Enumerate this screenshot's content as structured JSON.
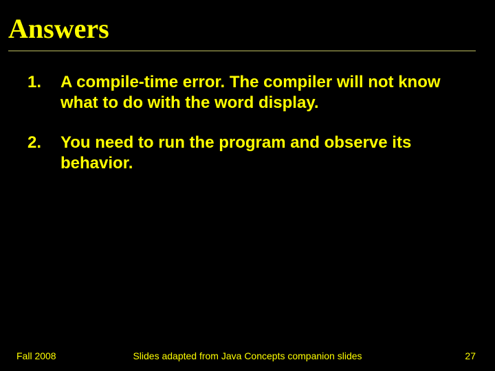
{
  "title": "Answers",
  "items": [
    {
      "number": "1.",
      "text": "A compile-time error. The compiler will not know what to do with the word display."
    },
    {
      "number": "2.",
      "text": "You need to run the program and observe its behavior."
    }
  ],
  "footer": {
    "left": "Fall 2008",
    "center": "Slides adapted from Java Concepts companion slides",
    "right": "27"
  }
}
